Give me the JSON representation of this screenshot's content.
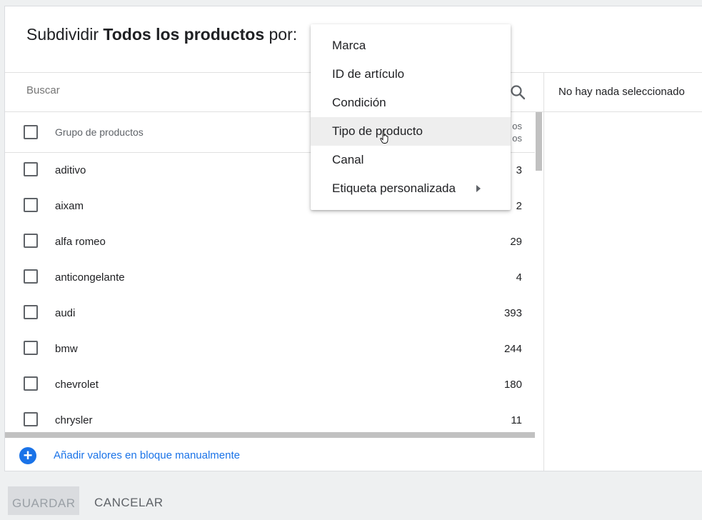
{
  "dialog": {
    "title_prefix": "Subdividir ",
    "title_bold": "Todos los productos",
    "title_suffix": " por:"
  },
  "search": {
    "placeholder": "Buscar",
    "icon": "search-icon"
  },
  "table": {
    "header_label": "Grupo de productos",
    "header_count_line1": "os",
    "header_count_line2": "os",
    "rows": [
      {
        "name": "aditivo",
        "count": "3"
      },
      {
        "name": "aixam",
        "count": "2"
      },
      {
        "name": "alfa romeo",
        "count": "29"
      },
      {
        "name": "anticongelante",
        "count": "4"
      },
      {
        "name": "audi",
        "count": "393"
      },
      {
        "name": "bmw",
        "count": "244"
      },
      {
        "name": "chevrolet",
        "count": "180"
      },
      {
        "name": "chrysler",
        "count": "11"
      }
    ]
  },
  "add_values": {
    "label": "Añadir valores en bloque manualmente",
    "icon": "plus-circle-icon"
  },
  "selection": {
    "empty_text": "No hay nada seleccionado"
  },
  "menu": {
    "items": [
      {
        "label": "Marca"
      },
      {
        "label": "ID de artículo"
      },
      {
        "label": "Condición"
      },
      {
        "label": "Tipo de producto"
      },
      {
        "label": "Canal"
      },
      {
        "label": "Etiqueta personalizada"
      }
    ],
    "hovered_index": 3
  },
  "footer": {
    "save_label": "GUARDAR",
    "cancel_label": "CANCELAR"
  },
  "colors": {
    "accent": "#1a73e8",
    "menu_hover": "#eeeeee"
  }
}
